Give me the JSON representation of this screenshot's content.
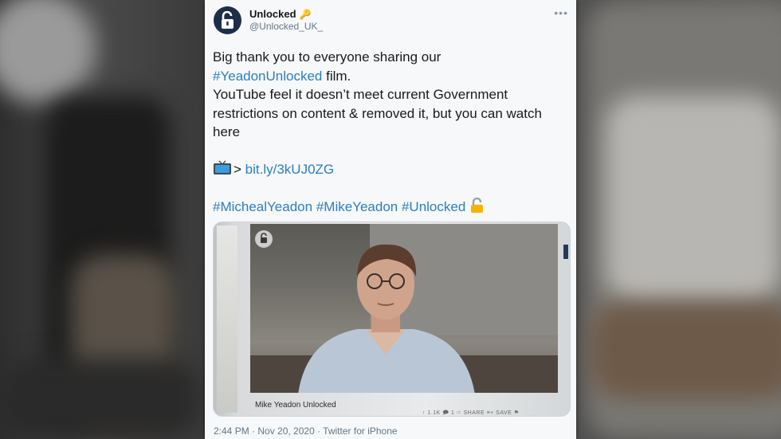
{
  "tweet": {
    "display_name": "Unlocked",
    "name_emoji": "🔑",
    "handle": "@Unlocked_UK_",
    "lines": {
      "l1": "Big thank you to everyone sharing our",
      "l2_tag": "#YeadonUnlocked",
      "l2_rest": " film.",
      "l3": "YouTube feel it doesn’t meet current Government",
      "l4": "restrictions on content & removed it, but you can watch",
      "l5": "here",
      "arrow": ">",
      "link": "bit.ly/3kUJ0ZG",
      "tag1": "#MichealYeadon",
      "tag2": "#MikeYeadon",
      "tag3": "#Unlocked"
    },
    "media_caption": "Mike Yeadon Unlocked",
    "media_stats": "↑ 1.1K    🗩 1    ⇨ SHARE    ≡+ SAVE    ⚑",
    "footer": "2:44 PM · Nov 20, 2020 · Twitter for iPhone"
  },
  "icons": {
    "avatar": "padlock-logo-icon",
    "key": "key-icon",
    "tv": "television-icon",
    "lock": "open-lock-icon",
    "more": "more-options-icon"
  },
  "colors": {
    "link": "#2a7fc0",
    "avatar_bg": "#1c2e4a",
    "card_bg": "#f7f8f9"
  }
}
